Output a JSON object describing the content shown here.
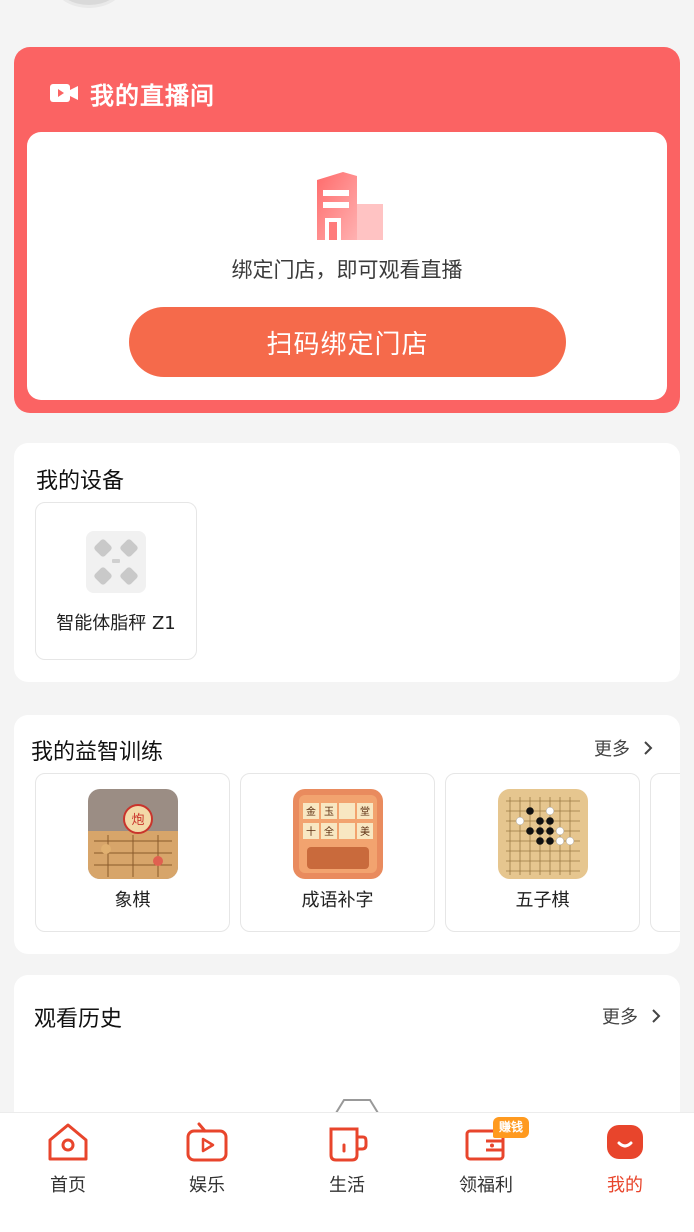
{
  "live": {
    "title": "我的直播间",
    "hint": "绑定门店，即可观看直播",
    "scan_button": "扫码绑定门店"
  },
  "devices": {
    "title": "我的设备",
    "items": [
      {
        "name": "智能体脂秤 Z1",
        "icon": "scale-icon"
      }
    ]
  },
  "training": {
    "title": "我的益智训练",
    "more": "更多",
    "items": [
      {
        "name": "象棋",
        "icon": "chinese-chess-thumbnail"
      },
      {
        "name": "成语补字",
        "icon": "idiom-game-thumbnail",
        "tiles": [
          "金",
          "玉",
          "",
          "堂",
          "十",
          "全",
          "",
          "美"
        ]
      },
      {
        "name": "五子棋",
        "icon": "gomoku-thumbnail"
      }
    ]
  },
  "history": {
    "title": "观看历史",
    "more": "更多"
  },
  "tabbar": {
    "items": [
      {
        "label": "首页",
        "icon": "home-icon"
      },
      {
        "label": "娱乐",
        "icon": "tv-play-icon"
      },
      {
        "label": "生活",
        "icon": "cup-icon"
      },
      {
        "label": "领福利",
        "icon": "wallet-icon",
        "badge": "赚钱"
      },
      {
        "label": "我的",
        "icon": "profile-icon",
        "active": true
      }
    ]
  },
  "colors": {
    "live_card": "#fb6363",
    "scan_button": "#f56a4b",
    "accent": "#e8452c",
    "badge": "#ff9a1f"
  }
}
